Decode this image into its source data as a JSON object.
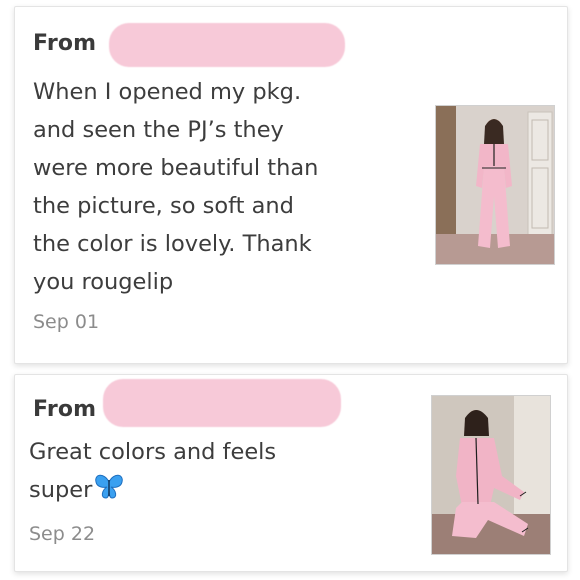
{
  "reviews": [
    {
      "from_label": "From",
      "text": "When I opened my pkg.\nand seen the PJ’s they\nwere more beautiful than\nthe picture, so soft and\nthe color is lovely. Thank\nyou rougelip",
      "date": "Sep 01",
      "photo_icon": "pink-pajamas-photo"
    },
    {
      "from_label": "From",
      "text": "Great colors and feels\nsuper",
      "emoji": "butterfly-icon",
      "date": "Sep 22",
      "photo_icon": "pink-pajamas-seated-photo"
    }
  ],
  "colors": {
    "redaction": "#f7c9d8",
    "text": "#3d3d3d",
    "date": "#8c8c8c",
    "butterfly": "#3aa0f0"
  }
}
